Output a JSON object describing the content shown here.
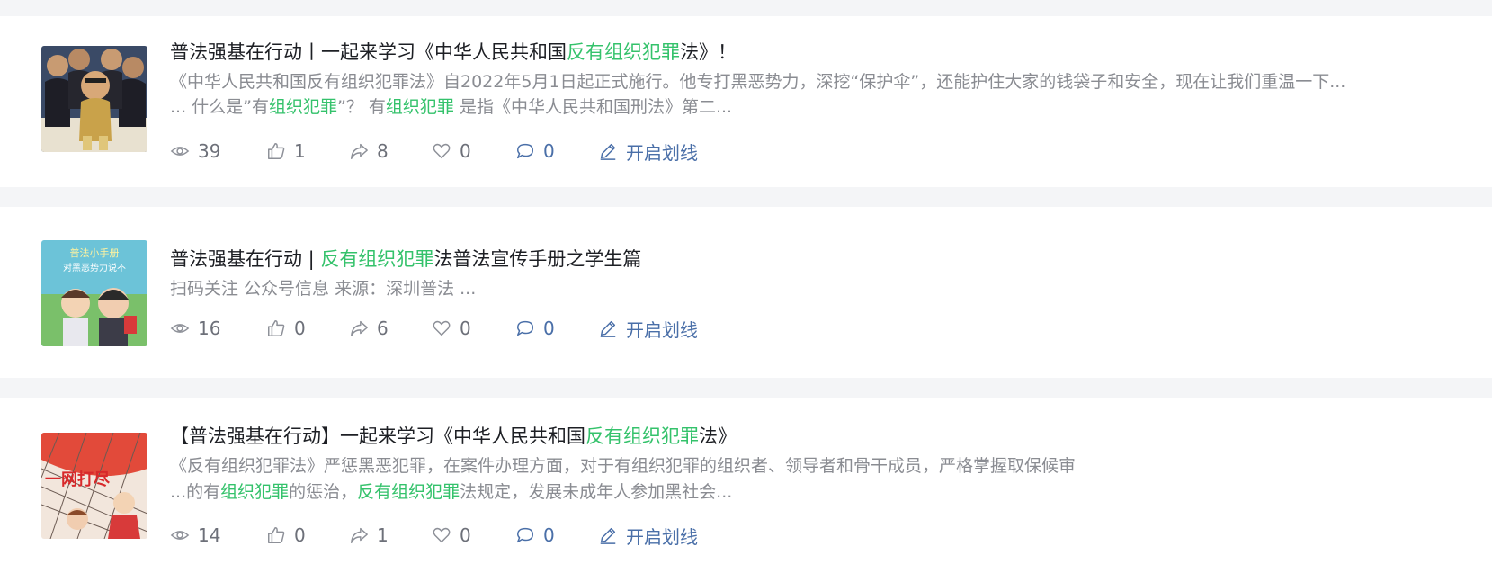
{
  "articles": [
    {
      "title_parts": [
        {
          "text": "普法强基在行动丨一起来学习《中华人民共和国",
          "hl": false
        },
        {
          "text": "反有组织犯罪",
          "hl": true
        },
        {
          "text": "法》！",
          "hl": false
        }
      ],
      "snippet_lines": [
        [
          {
            "text": "《中华人民共和国反有组织犯罪法》自2022年5月1日起正式施行。他专打黑恶势力，深挖“保护伞”，还能护住大家的钱袋子和安全，现在让我们重温一下...",
            "hl": false
          }
        ],
        [
          {
            "text": "... 什么是”有",
            "hl": false
          },
          {
            "text": "组织犯罪",
            "hl": true
          },
          {
            "text": "”？ 有",
            "hl": false
          },
          {
            "text": "组织犯罪",
            "hl": true
          },
          {
            "text": " 是指《中华人民共和国刑法》第二...",
            "hl": false
          }
        ]
      ],
      "views": "39",
      "likes": "1",
      "shares": "8",
      "favorites": "0",
      "comments": "0",
      "highlight_label": "开启划线"
    },
    {
      "title_parts": [
        {
          "text": "普法强基在行动 | ",
          "hl": false
        },
        {
          "text": "反有组织犯罪",
          "hl": true
        },
        {
          "text": "法普法宣传手册之学生篇",
          "hl": false
        }
      ],
      "snippet_lines": [
        [
          {
            "text": "扫码关注 公众号信息 来源：深圳普法 ...",
            "hl": false
          }
        ]
      ],
      "views": "16",
      "likes": "0",
      "shares": "6",
      "favorites": "0",
      "comments": "0",
      "highlight_label": "开启划线"
    },
    {
      "title_parts": [
        {
          "text": "【普法强基在行动】一起来学习《中华人民共和国",
          "hl": false
        },
        {
          "text": "反有组织犯罪",
          "hl": true
        },
        {
          "text": "法》",
          "hl": false
        }
      ],
      "snippet_lines": [
        [
          {
            "text": "《反有组织犯罪法》严惩黑恶犯罪，在案件办理方面，对于有组织犯罪的组织者、领导者和骨干成员，严格掌握取保候审",
            "hl": false
          }
        ],
        [
          {
            "text": "...的有",
            "hl": false
          },
          {
            "text": "组织犯罪",
            "hl": true
          },
          {
            "text": "的惩治，",
            "hl": false
          },
          {
            "text": "反有组织犯罪",
            "hl": true
          },
          {
            "text": "法规定，发展未成年人参加黑社会...",
            "hl": false
          }
        ]
      ],
      "views": "14",
      "likes": "0",
      "shares": "1",
      "favorites": "0",
      "comments": "0",
      "highlight_label": "开启划线"
    }
  ],
  "thumbnails": [
    {
      "icon": "crowd-illustration",
      "text": ""
    },
    {
      "icon": "cartoon-students-illustration",
      "text": "普法小手册 对黑恶势力说不"
    },
    {
      "icon": "red-net-illustration",
      "text": "一网打尽"
    }
  ],
  "colors": {
    "highlight": "#34c26b",
    "background": "#f4f5f7",
    "title": "#1d1f24",
    "snippet": "#8a8c92",
    "meta": "#6d7079"
  }
}
